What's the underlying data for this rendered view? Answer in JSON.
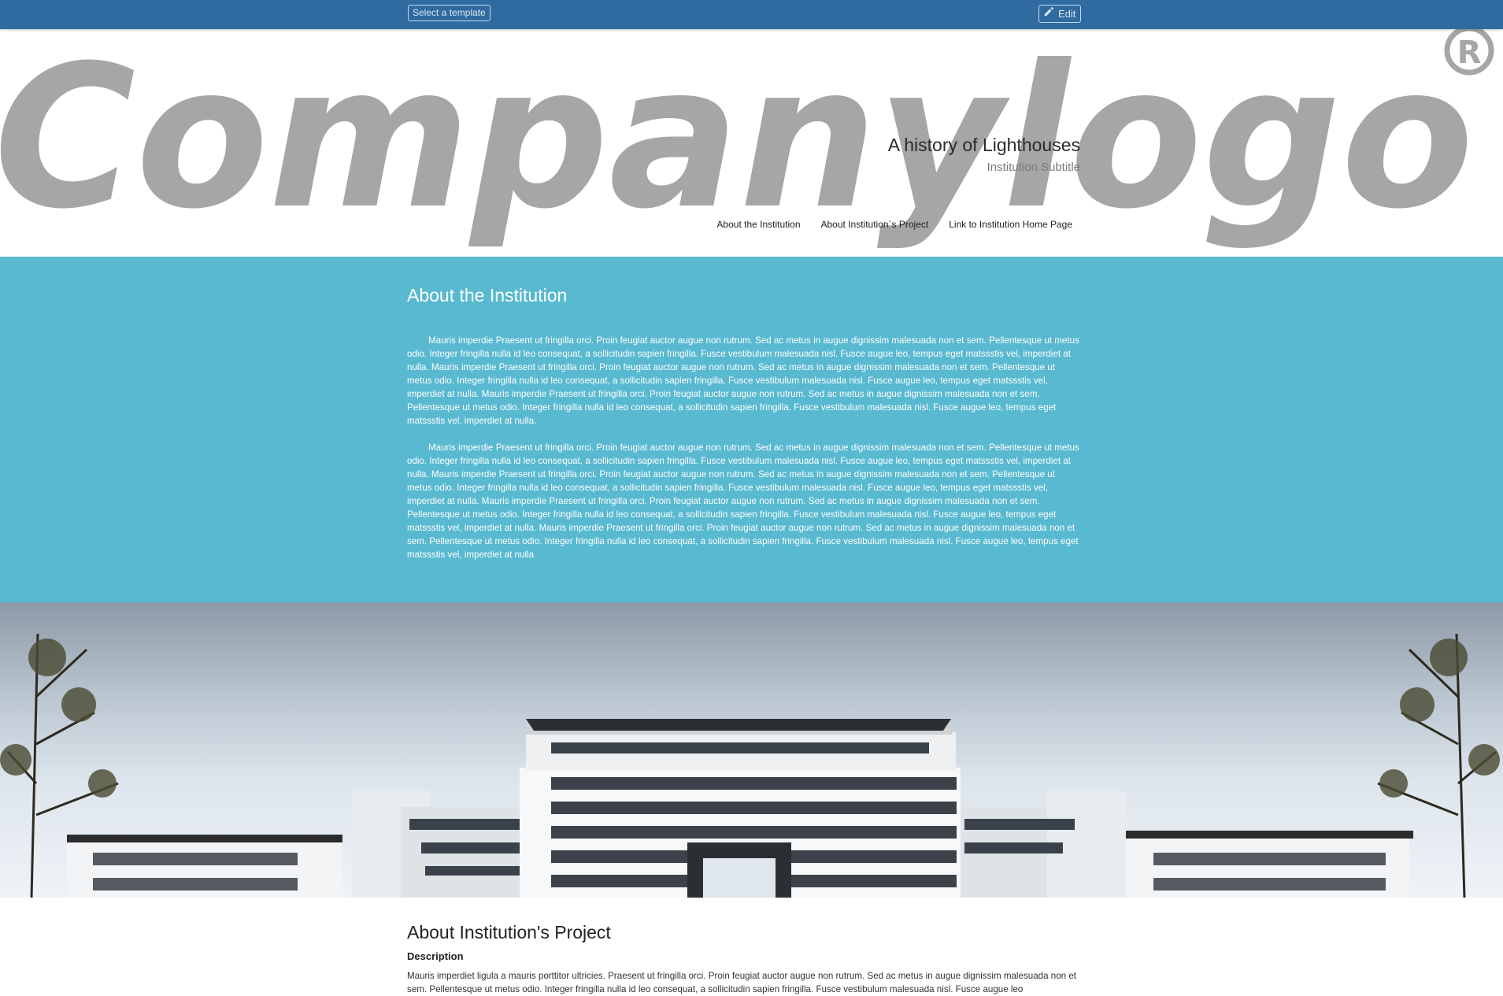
{
  "topbar": {
    "template_select_label": "Select a template",
    "edit_label": "Edit",
    "edit_icon": "pencil-icon",
    "background_color": "#2f6aa0"
  },
  "header": {
    "logo_text": "Companylogo",
    "logo_registered_mark": "®",
    "title": "A history of Lighthouses",
    "subtitle": "Institution Subtitle",
    "nav_items": [
      "About the Institution",
      "About Institution`s Project",
      "Link to Institution Home Page"
    ]
  },
  "about": {
    "heading": "About the Institution",
    "background_color": "#58b9d0",
    "paragraphs": [
      "Mauris imperdie Praesent ut fringilla orci. Proin feugiat auctor augue non rutrum. Sed ac metus in augue dignissim malesuada non et sem. Pellentesque ut metus odio. Integer fringilla nulla id leo consequat, a sollicitudin sapien fringilla. Fusce vestibulum malesuada nisl. Fusce augue leo, tempus eget matssstis vel, imperdiet at nulla. Mauris imperdie Praesent ut fringilla orci. Proin feugiat auctor augue non rutrum. Sed ac metus in augue dignissim malesuada non et sem. Pellentesque ut metus odio. Integer fringilla nulla id leo consequat, a sollicitudin sapien fringilla. Fusce vestibulum malesuada nisl. Fusce augue leo, tempus eget matssstis vel, imperdiet at nulla. Mauris imperdie Praesent ut fringilla orci. Proin feugiat auctor augue non rutrum. Sed ac metus in augue dignissim malesuada non et sem. Pellentesque ut metus odio. Integer fringilla nulla id leo consequat, a sollicitudin sapien fringilla. Fusce vestibulum malesuada nisl. Fusce augue leo, tempus eget matssstis vel, imperdiet at nulla.",
      "Mauris imperdie Praesent ut fringilla orci. Proin feugiat auctor augue non rutrum. Sed ac metus in augue dignissim malesuada non et sem. Pellentesque ut metus odio. Integer fringilla nulla id leo consequat, a sollicitudin sapien fringilla. Fusce vestibulum malesuada nisl. Fusce augue leo, tempus eget matssstis vel, imperdiet at nulla. Mauris imperdie Praesent ut fringilla orci. Proin feugiat auctor augue non rutrum. Sed ac metus in augue dignissim malesuada non et sem. Pellentesque ut metus odio. Integer fringilla nulla id leo consequat, a sollicitudin sapien fringilla. Fusce vestibulum malesuada nisl. Fusce augue leo, tempus eget matssstis vel, imperdiet at nulla. Mauris imperdie Praesent ut fringilla orci. Proin feugiat auctor augue non rutrum. Sed ac metus in augue dignissim malesuada non et sem. Pellentesque ut metus odio. Integer fringilla nulla id leo consequat, a sollicitudin sapien fringilla. Fusce vestibulum malesuada nisl. Fusce augue leo, tempus eget matssstis vel, imperdiet at nulla. Mauris imperdie Praesent ut fringilla orci. Proin feugiat auctor augue non rutrum. Sed ac metus in augue dignissim malesuada non et sem. Pellentesque ut metus odio. Integer fringilla nulla id leo consequat, a sollicitudin sapien fringilla. Fusce vestibulum malesuada nisl. Fusce augue leo, tempus eget matssstis vel, imperdiet at nulla"
    ]
  },
  "project": {
    "heading": "About Institution's Project",
    "subheading": "Description",
    "paragraph": "Mauris imperdiet ligula a mauris porttitor ultricies. Praesent ut fringilla orci. Proin feugiat auctor augue non rutrum. Sed ac metus in augue dignissim malesuada non et sem. Pellentesque ut metus odio. Integer fringilla nulla id leo consequat, a sollicitudin sapien fringilla. Fusce vestibulum malesuada nisl. Fusce augue leo"
  }
}
